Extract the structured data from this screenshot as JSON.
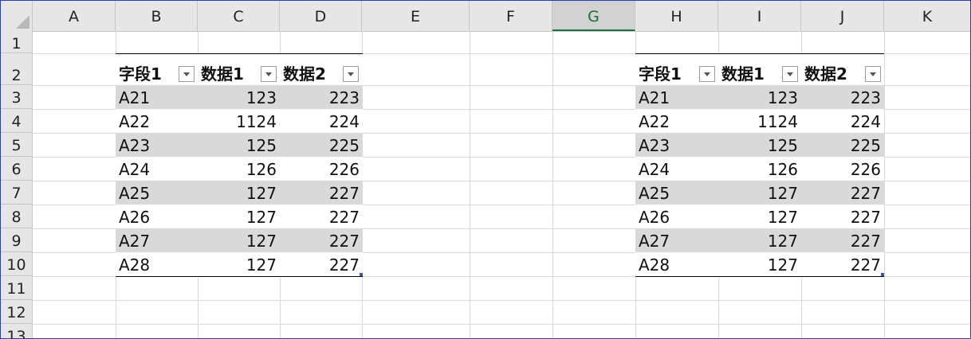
{
  "sheet": {
    "columns": [
      "A",
      "B",
      "C",
      "D",
      "E",
      "F",
      "G",
      "H",
      "I",
      "J",
      "K"
    ],
    "selected_column": "G",
    "rows": [
      "1",
      "2",
      "3",
      "4",
      "5",
      "6",
      "7",
      "8",
      "9",
      "10",
      "11",
      "12",
      "13"
    ]
  },
  "tables": [
    {
      "headers": [
        "字段1",
        "数据1",
        "数据2"
      ],
      "rows": [
        [
          "A21",
          "123",
          "223"
        ],
        [
          "A22",
          "1124",
          "224"
        ],
        [
          "A23",
          "125",
          "225"
        ],
        [
          "A24",
          "126",
          "226"
        ],
        [
          "A25",
          "127",
          "227"
        ],
        [
          "A26",
          "127",
          "227"
        ],
        [
          "A27",
          "127",
          "227"
        ],
        [
          "A28",
          "127",
          "227"
        ]
      ]
    },
    {
      "headers": [
        "字段1",
        "数据1",
        "数据2"
      ],
      "rows": [
        [
          "A21",
          "123",
          "223"
        ],
        [
          "A22",
          "1124",
          "224"
        ],
        [
          "A23",
          "125",
          "225"
        ],
        [
          "A24",
          "126",
          "226"
        ],
        [
          "A25",
          "127",
          "227"
        ],
        [
          "A26",
          "127",
          "227"
        ],
        [
          "A27",
          "127",
          "227"
        ],
        [
          "A28",
          "127",
          "227"
        ]
      ]
    }
  ],
  "colors": {
    "band": "#d9d9d9",
    "header_bar": "#e6e6e6",
    "selected_column_accent": "#217346",
    "frame_border": "#2b3fa8"
  }
}
